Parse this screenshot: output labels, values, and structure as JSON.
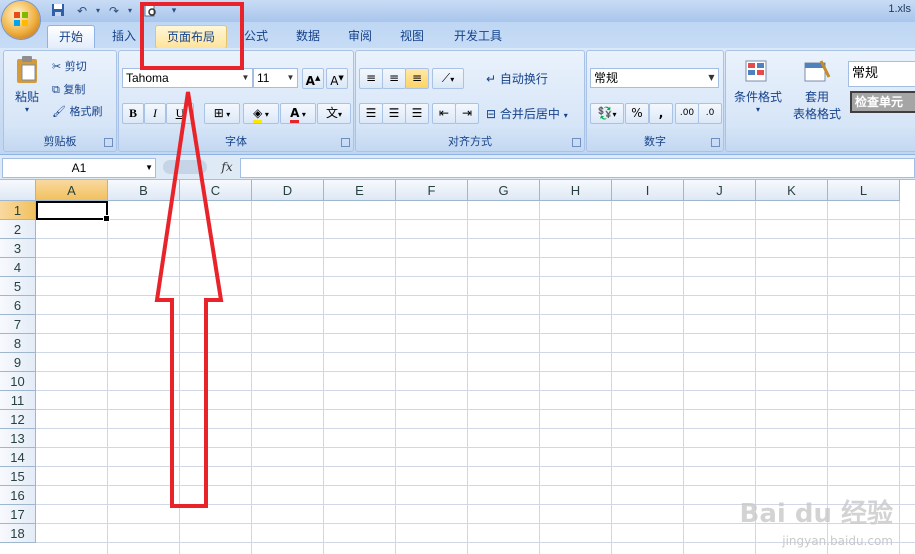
{
  "window": {
    "title": "1.xls"
  },
  "quick_access": {
    "save_icon": "save-icon",
    "undo_icon": "undo-icon",
    "redo_icon": "redo-icon",
    "print_icon": "print-preview-icon",
    "more_icon": "customize-icon"
  },
  "tabs": [
    {
      "label": "开始",
      "active": true
    },
    {
      "label": "插入"
    },
    {
      "label": "页面布局"
    },
    {
      "label": "公式"
    },
    {
      "label": "数据"
    },
    {
      "label": "审阅"
    },
    {
      "label": "视图"
    },
    {
      "label": "开发工具"
    }
  ],
  "ribbon": {
    "clipboard": {
      "label": "剪贴板",
      "paste": "粘贴",
      "cut": "剪切",
      "copy": "复制",
      "format_painter": "格式刷"
    },
    "font": {
      "label": "字体",
      "font_name": "Tahoma",
      "font_size": "11",
      "bold": "B",
      "italic": "I",
      "underline": "U",
      "font_color_letter": "A",
      "font_color": "#e8232a",
      "fill_color": "#ffe800",
      "phonetic": "文"
    },
    "alignment": {
      "label": "对齐方式",
      "wrap_text": "自动换行",
      "merge_center": "合并后居中"
    },
    "number": {
      "label": "数字",
      "format": "常规",
      "percent": "%",
      "comma": ",",
      "inc_decimal": ".00",
      "dec_decimal": ".0"
    },
    "styles": {
      "conditional": "条件格式",
      "table_format_1": "套用",
      "table_format_2": "表格格式",
      "style_normal": "常规",
      "style_check": "检查单元"
    }
  },
  "formula_bar": {
    "name_box": "A1",
    "fx": "fx",
    "content": ""
  },
  "grid": {
    "columns": [
      "A",
      "B",
      "C",
      "D",
      "E",
      "F",
      "G",
      "H",
      "I",
      "J",
      "K",
      "L"
    ],
    "rows": [
      "1",
      "2",
      "3",
      "4",
      "5",
      "6",
      "7",
      "8",
      "9",
      "10",
      "11",
      "12",
      "13",
      "14",
      "15",
      "16",
      "17",
      "18"
    ],
    "selected_cell": "A1"
  },
  "annotation": {
    "color": "#e8232a"
  },
  "watermark": {
    "text": "Bai du 经验",
    "url": "jingyan.baidu.com"
  }
}
